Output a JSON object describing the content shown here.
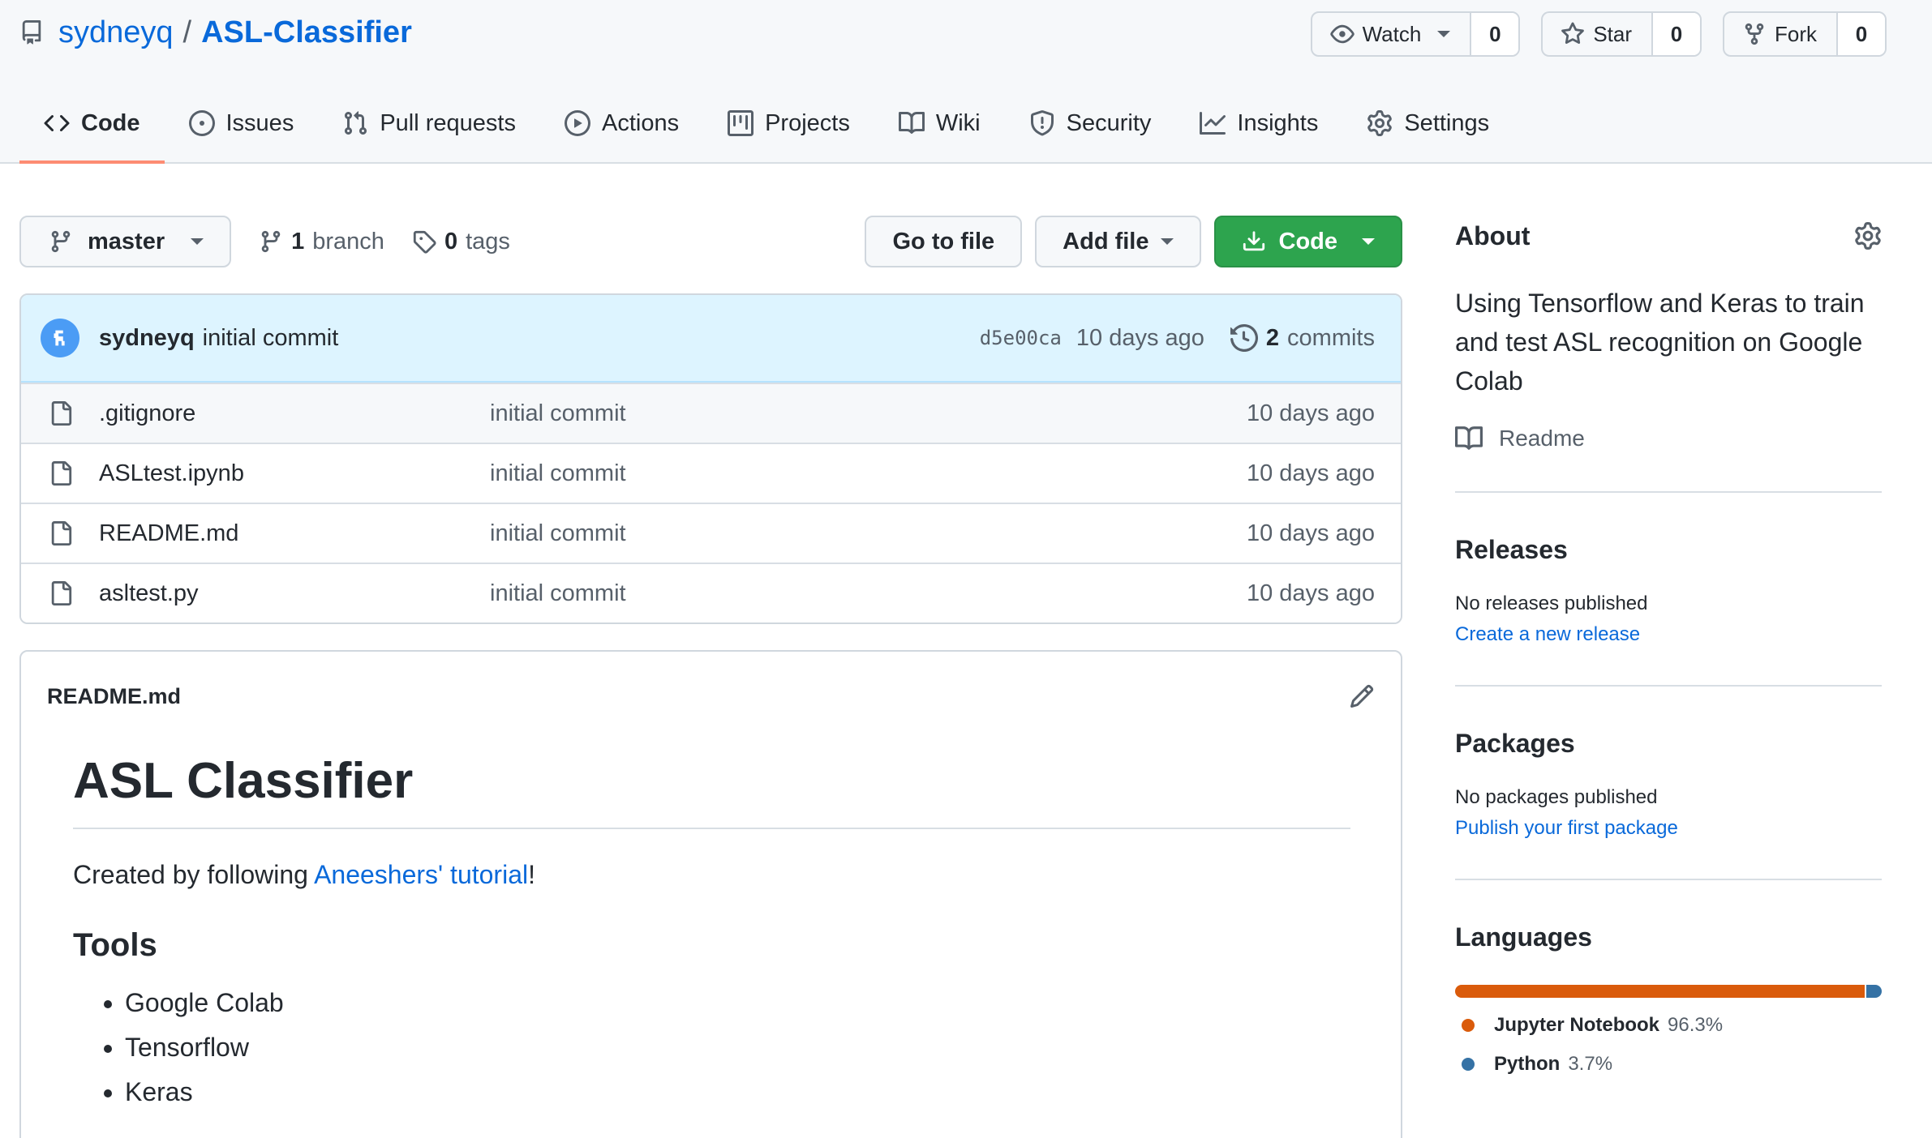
{
  "repo": {
    "owner": "sydneyq",
    "separator": "/",
    "name": "ASL-Classifier"
  },
  "repo_actions": {
    "watch": {
      "label": "Watch",
      "count": "0"
    },
    "star": {
      "label": "Star",
      "count": "0"
    },
    "fork": {
      "label": "Fork",
      "count": "0"
    }
  },
  "tabs": [
    {
      "label": "Code",
      "icon": "code-icon",
      "active": true
    },
    {
      "label": "Issues",
      "icon": "issue-icon"
    },
    {
      "label": "Pull requests",
      "icon": "pull-request-icon"
    },
    {
      "label": "Actions",
      "icon": "play-icon"
    },
    {
      "label": "Projects",
      "icon": "project-icon"
    },
    {
      "label": "Wiki",
      "icon": "book-icon"
    },
    {
      "label": "Security",
      "icon": "shield-icon"
    },
    {
      "label": "Insights",
      "icon": "graph-icon"
    },
    {
      "label": "Settings",
      "icon": "gear-icon"
    }
  ],
  "toolbar": {
    "branch": "master",
    "branch_count": "1",
    "branch_label": "branch",
    "tag_count": "0",
    "tag_label": "tags",
    "go_to_file": "Go to file",
    "add_file": "Add file",
    "code": "Code"
  },
  "latest_commit": {
    "author": "sydneyq",
    "message": "initial commit",
    "sha": "d5e00ca",
    "age": "10 days ago",
    "commit_count": "2",
    "commits_label": "commits"
  },
  "files": [
    {
      "name": ".gitignore",
      "message": "initial commit",
      "age": "10 days ago"
    },
    {
      "name": "ASLtest.ipynb",
      "message": "initial commit",
      "age": "10 days ago"
    },
    {
      "name": "README.md",
      "message": "initial commit",
      "age": "10 days ago"
    },
    {
      "name": "asltest.py",
      "message": "initial commit",
      "age": "10 days ago"
    }
  ],
  "readme": {
    "filename": "README.md",
    "title": "ASL Classifier",
    "intro_prefix": "Created by following ",
    "intro_link": "Aneeshers' tutorial",
    "intro_suffix": "!",
    "tools_heading": "Tools",
    "tools": [
      "Google Colab",
      "Tensorflow",
      "Keras"
    ]
  },
  "about": {
    "heading": "About",
    "description": "Using Tensorflow and Keras to train and test ASL recognition on Google Colab",
    "readme_label": "Readme"
  },
  "releases": {
    "heading": "Releases",
    "status": "No releases published",
    "link": "Create a new release"
  },
  "packages": {
    "heading": "Packages",
    "status": "No packages published",
    "link": "Publish your first package"
  },
  "languages": {
    "heading": "Languages",
    "items": [
      {
        "name": "Jupyter Notebook",
        "percent": "96.3%",
        "share": 96.3,
        "color": "#DA5B0B"
      },
      {
        "name": "Python",
        "percent": "3.7%",
        "share": 3.7,
        "color": "#3572A5"
      }
    ]
  },
  "colors": {
    "accent_link": "#0969da",
    "primary_button": "#2da44e",
    "active_tab_underline": "#fd8c73",
    "commit_bar_bg": "#ddf4ff"
  }
}
